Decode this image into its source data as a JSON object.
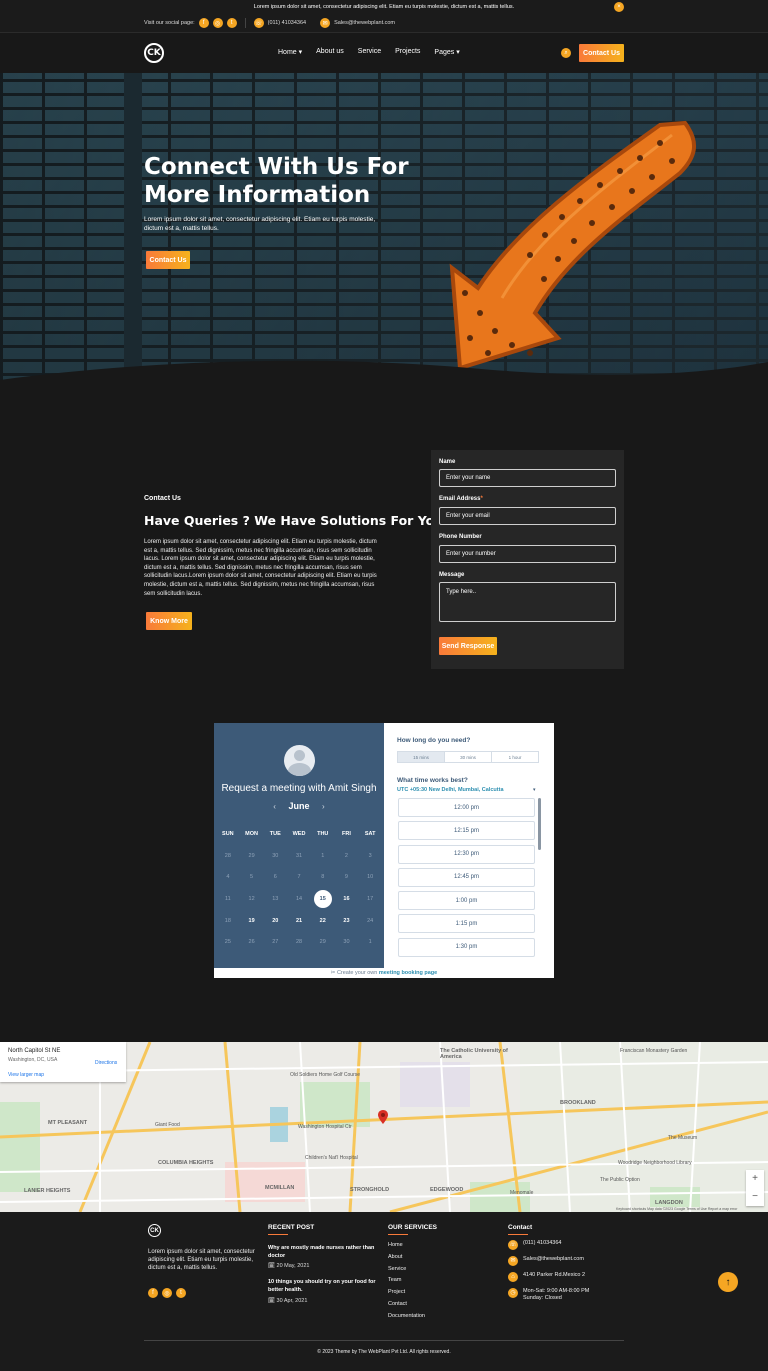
{
  "topbar": {
    "announcement": "Lorem ipsum dolor sit amet, consectetur adipiscing elit. Etiam eu turpis molestie, dictum est a, mattis tellus.",
    "close_icon": "×",
    "social_label": "Visit our social page:",
    "phone": "(011) 41034364",
    "email": "Sales@thewebplant.com"
  },
  "nav": {
    "logo_text": "CK",
    "items": [
      {
        "label": "Home ▾"
      },
      {
        "label": "About us"
      },
      {
        "label": "Service"
      },
      {
        "label": "Projects"
      },
      {
        "label": "Pages ▾"
      }
    ],
    "cta_label": "Contact Us"
  },
  "hero": {
    "title": "Connect With Us For More Information",
    "text": "Lorem ipsum dolor sit amet, consectetur adipiscing elit. Etiam eu turpis molestie, dictum est a, mattis tellus.",
    "button_label": "Contact Us"
  },
  "contact": {
    "label": "Contact Us",
    "title": "Have Queries ? We Have Solutions For You.",
    "text": "Lorem ipsum dolor sit amet, consectetur adipiscing elit. Etiam eu turpis molestie, dictum est a, mattis tellus. Sed dignissim, metus nec fringilla accumsan, risus sem sollicitudin lacus. Lorem ipsum dolor sit amet, consectetur adipiscing elit. Etiam eu turpis molestie, dictum est a, mattis tellus. Sed dignissim, metus nec fringilla accumsan, risus sem sollicitudin lacus.Lorem ipsum dolor sit amet, consectetur adipiscing elit. Etiam eu turpis molestie, dictum est a, mattis tellus. Sed dignissim, metus nec fringilla accumsan, risus sem sollicitudin lacus.",
    "button_label": "Know More"
  },
  "form": {
    "name_label": "Name",
    "name_placeholder": "Enter your name",
    "email_label": "Email Address",
    "email_req": "*",
    "email_placeholder": "Enter your email",
    "phone_label": "Phone Number",
    "phone_placeholder": "Enter your number",
    "message_label": "Message",
    "message_placeholder": "Type here..",
    "submit_label": "Send Response"
  },
  "booking": {
    "title": "Request a meeting with Amit Singh",
    "month": "June",
    "prev": "‹",
    "next": "›",
    "weekdays": [
      "SUN",
      "MON",
      "TUE",
      "WED",
      "THU",
      "FRI",
      "SAT"
    ],
    "weeks": [
      [
        {
          "d": "28"
        },
        {
          "d": "29"
        },
        {
          "d": "30"
        },
        {
          "d": "31"
        },
        {
          "d": "1"
        },
        {
          "d": "2"
        },
        {
          "d": "3"
        }
      ],
      [
        {
          "d": "4"
        },
        {
          "d": "5"
        },
        {
          "d": "6"
        },
        {
          "d": "7"
        },
        {
          "d": "8"
        },
        {
          "d": "9"
        },
        {
          "d": "10"
        }
      ],
      [
        {
          "d": "11"
        },
        {
          "d": "12"
        },
        {
          "d": "13"
        },
        {
          "d": "14"
        },
        {
          "d": "15",
          "state": "sel"
        },
        {
          "d": "16",
          "state": "active"
        },
        {
          "d": "17"
        }
      ],
      [
        {
          "d": "18"
        },
        {
          "d": "19",
          "state": "active"
        },
        {
          "d": "20",
          "state": "active"
        },
        {
          "d": "21",
          "state": "active"
        },
        {
          "d": "22",
          "state": "active"
        },
        {
          "d": "23",
          "state": "active"
        },
        {
          "d": "24"
        }
      ],
      [
        {
          "d": "25"
        },
        {
          "d": "26"
        },
        {
          "d": "27"
        },
        {
          "d": "28"
        },
        {
          "d": "29"
        },
        {
          "d": "30"
        },
        {
          "d": "1"
        }
      ]
    ],
    "duration_question": "How long do you need?",
    "durations": [
      {
        "label": "15 mins",
        "on": true
      },
      {
        "label": "30 mins",
        "on": false
      },
      {
        "label": "1 hour",
        "on": false
      }
    ],
    "time_question": "What time works best?",
    "timezone": "UTC +05:30 New Delhi, Mumbai, Calcutta",
    "timezone_caret": "▾",
    "slots": [
      "12:00 pm",
      "12:15 pm",
      "12:30 pm",
      "12:45 pm",
      "1:00 pm",
      "1:15 pm",
      "1:30 pm"
    ],
    "footer_prefix": "Create your own",
    "footer_link": "meeting booking page"
  },
  "map": {
    "card_title": "North Capitol St NE",
    "card_sub": "Washington, DC, USA",
    "card_link": "View larger map",
    "directions": "Directions",
    "labels": [
      {
        "t": "The Catholic University of America",
        "c": "big"
      },
      {
        "t": "Franciscan Monastery Garden",
        "c": ""
      },
      {
        "t": "Washington Hospital Ctr",
        "c": ""
      },
      {
        "t": "Children's Nat'l Hospital",
        "c": ""
      },
      {
        "t": "MT PLEASANT",
        "c": "big"
      },
      {
        "t": "COLUMBIA HEIGHTS",
        "c": "big"
      },
      {
        "t": "BROOKLAND",
        "c": "big"
      },
      {
        "t": "EDGEWOOD",
        "c": "big"
      },
      {
        "t": "STRONGHOLD",
        "c": "big"
      },
      {
        "t": "LANIER HEIGHTS",
        "c": "big"
      },
      {
        "t": "Old Soldiers Home Golf Course",
        "c": ""
      },
      {
        "t": "The Museum",
        "c": ""
      },
      {
        "t": "Giant Food",
        "c": ""
      },
      {
        "t": "Woodridge Neighborhood Library",
        "c": ""
      },
      {
        "t": "The Public Option",
        "c": ""
      },
      {
        "t": "Menomale",
        "c": ""
      },
      {
        "t": "MCMILLAN",
        "c": "big"
      },
      {
        "t": "LANGDON",
        "c": "big"
      }
    ],
    "zoom_in": "+",
    "zoom_out": "−",
    "attribution": "Keyboard shortcuts  Map data ©2023 Google  Terms of Use  Report a map error"
  },
  "footer": {
    "logo_text": "CK",
    "about": "Lorem ipsum dolor sit amet, consectetur adipiscing elit. Etiam eu turpis molestie, dictum est a, mattis tellus.",
    "recent_title": "RECENT POST",
    "posts": [
      {
        "title": "Why are mostly made nurses rather than doctor",
        "date": "20 May, 2021"
      },
      {
        "title": "10 things you should try on your food for better health.",
        "date": "30 Apr, 2021"
      }
    ],
    "services_title": "OUR SERVICES",
    "services": [
      "Home",
      "About",
      "Service",
      "Team",
      "Project",
      "Contact",
      "Documentation"
    ],
    "contact_title": "Contact",
    "contacts": [
      {
        "icon": "phone-icon",
        "text": "(011) 41034364"
      },
      {
        "icon": "mail-icon",
        "text": "Sales@thewebplant.com"
      },
      {
        "icon": "location-icon",
        "text": "4140 Parker Rd.Mexico 2"
      },
      {
        "icon": "clock-icon",
        "text": "Mon-Sat: 9:00 AM-8:00 PM\nSunday: Closed"
      }
    ],
    "copyright": "© 2023 Theme by The WebPlant Pvt Ltd. All rights reserved.",
    "to_top": "↑"
  },
  "colors": {
    "accent": "#f5a623",
    "accent_start": "#f97a3a",
    "background": "#181818",
    "calendar_blue": "#3d5a78"
  }
}
